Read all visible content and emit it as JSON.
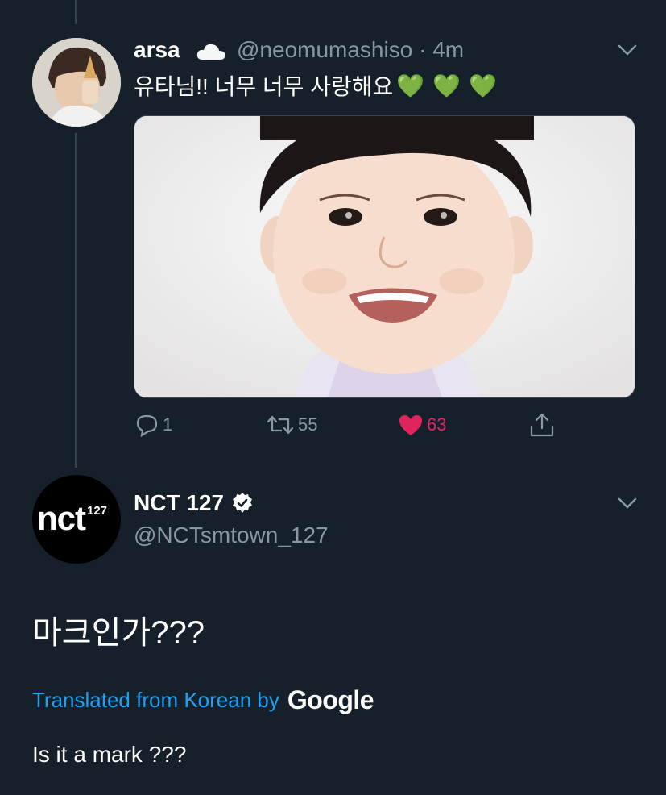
{
  "reply_tweet": {
    "display_name": "arsa",
    "handle": "@neomumashiso",
    "separator": "·",
    "time": "4m",
    "text": "유타님!! 너무 너무 사랑해요",
    "emoji": [
      "💚",
      "💚",
      "💚"
    ],
    "image_desc": "toddler-portrait-photo",
    "actions": {
      "reply_count": "1",
      "retweet_count": "55",
      "like_count": "63",
      "liked": true
    }
  },
  "main_tweet": {
    "display_name": "NCT 127",
    "verified": true,
    "handle": "@NCTsmtown_127",
    "avatar_logo": "nct",
    "avatar_logo_sup": "127",
    "text": "마크인가???",
    "translated_prefix": "Translated from Korean by",
    "translated_provider": "Google",
    "translation": "Is it a mark ???"
  },
  "colors": {
    "background": "#15202b",
    "secondary_text": "#8899a6",
    "link": "#1da1f2",
    "like": "#e0245e",
    "divider": "#38444d",
    "heart_green": "#3fbf3f"
  }
}
